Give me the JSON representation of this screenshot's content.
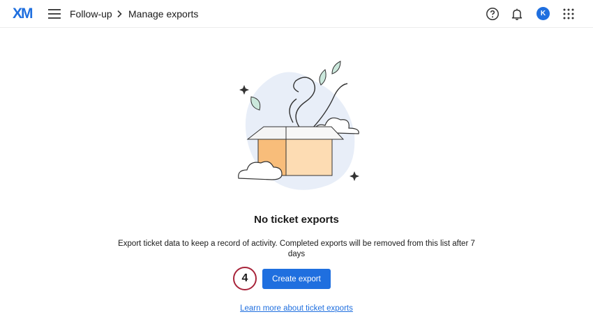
{
  "app": {
    "logo_text": "XM",
    "brand_color": "#1f6fdf"
  },
  "breadcrumb": {
    "parent": "Follow-up",
    "current": "Manage exports"
  },
  "header": {
    "help_icon": "help-circle-icon",
    "notifications_icon": "bell-icon",
    "avatar_initial": "K",
    "apps_icon": "grid-apps-icon"
  },
  "empty_state": {
    "title": "No ticket exports",
    "description": "Export ticket data to keep a record of activity. Completed exports will be removed from this list after 7 days",
    "create_button": "Create export",
    "learn_link": "Learn more about ticket exports"
  },
  "annotation": {
    "step_number": "4",
    "color": "#a8243a"
  }
}
